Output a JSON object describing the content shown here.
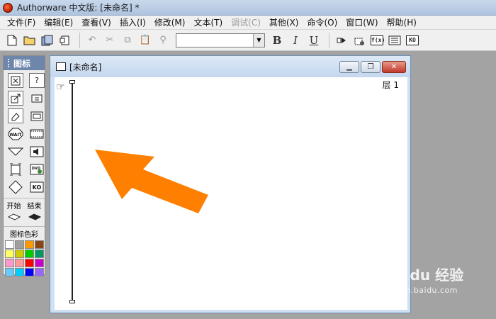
{
  "titlebar": {
    "title": "Authorware 中文版: [未命名] *"
  },
  "menubar": {
    "items": [
      {
        "label": "文件(F)",
        "enabled": true
      },
      {
        "label": "编辑(E)",
        "enabled": true
      },
      {
        "label": "查看(V)",
        "enabled": true
      },
      {
        "label": "插入(I)",
        "enabled": true
      },
      {
        "label": "修改(M)",
        "enabled": true
      },
      {
        "label": "文本(T)",
        "enabled": true
      },
      {
        "label": "调试(C)",
        "enabled": false
      },
      {
        "label": "其他(X)",
        "enabled": true
      },
      {
        "label": "命令(O)",
        "enabled": true
      },
      {
        "label": "窗口(W)",
        "enabled": true
      },
      {
        "label": "帮助(H)",
        "enabled": true
      }
    ]
  },
  "toolbar": {
    "font_select_value": "",
    "bold": "B",
    "italic": "I",
    "underline": "U",
    "fx_label": "f(x)",
    "ko_label": "KO"
  },
  "palette": {
    "title": "图标",
    "start_label": "开始",
    "end_label": "结束",
    "color_title": "图标色彩",
    "wait_label": "WAIT",
    "dvd_label": "DVD",
    "ko_label": "KO",
    "swatches": [
      "#ffffff",
      "#a0a0a0",
      "#ff9900",
      "#8b4513",
      "#ffff66",
      "#cccc00",
      "#00cc00",
      "#009966",
      "#ff99cc",
      "#ff9999",
      "#ff0000",
      "#cc00cc",
      "#66ccff",
      "#00ccff",
      "#0000ff",
      "#9966ff"
    ]
  },
  "flowwin": {
    "title": "[未命名]",
    "layer": "层 1"
  },
  "watermark": {
    "brand": "Bai du 经验",
    "url": "jingyan.baidu.com"
  },
  "colors": {
    "arrow": "#ff7f00",
    "title_gradient_start": "#c9d9ec",
    "palette_header": "#6d86aa"
  }
}
